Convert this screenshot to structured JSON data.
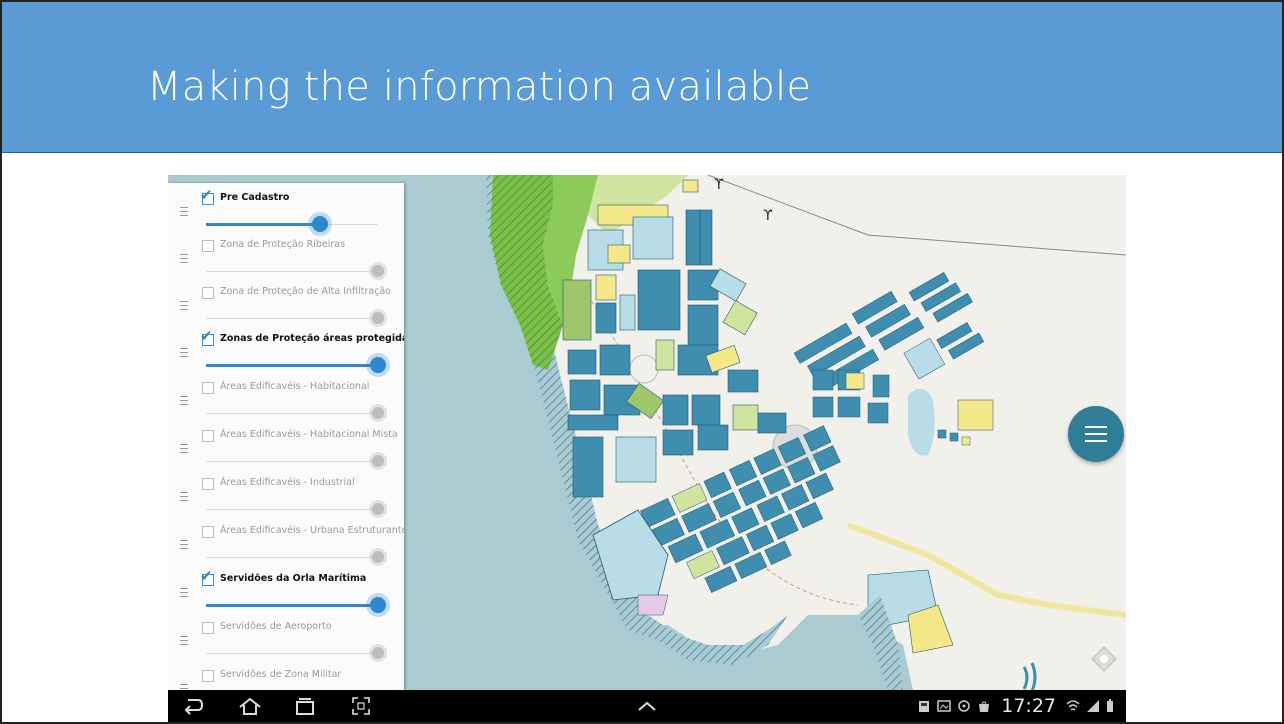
{
  "slide": {
    "title": "Making the information available"
  },
  "layers": [
    {
      "label": "Pre Cadastro",
      "checked": true,
      "opacity": 0.64
    },
    {
      "label": "Zona de Proteção Ribeiras",
      "checked": false,
      "opacity": 1.0
    },
    {
      "label": "Zona de Proteção de Alta Infiltração",
      "checked": false,
      "opacity": 1.0
    },
    {
      "label": "Zonas de Proteção áreas protegidas",
      "checked": true,
      "opacity": 1.0
    },
    {
      "label": "Áreas Edificavéis - Habitacional",
      "checked": false,
      "opacity": 1.0
    },
    {
      "label": "Áreas Edificavéis - Habitacional Mista",
      "checked": false,
      "opacity": 1.0
    },
    {
      "label": "Áreas Edificavéis - Industrial",
      "checked": false,
      "opacity": 1.0
    },
    {
      "label": "Áreas Edificavéis - Urbana Estruturante",
      "checked": false,
      "opacity": 1.0
    },
    {
      "label": "Servidões da Orla Marítima",
      "checked": true,
      "opacity": 1.0
    },
    {
      "label": "Servidões de Aeroporto",
      "checked": false,
      "opacity": 1.0
    },
    {
      "label": "Servidões de Zona Militar",
      "checked": false,
      "opacity": 1.0
    }
  ],
  "map": {
    "menu_icon": "hamburger-icon",
    "locate_icon": "compass-icon",
    "colors": {
      "sea": "#aacbd1",
      "land": "#f2f0ea",
      "parcel": "#3f8eb0",
      "parcel_light": "#b9dde6",
      "green": "#c9df9b",
      "dark_green": "#6aa84f",
      "yellow": "#f5e88a"
    }
  },
  "status_bar": {
    "clock": "17:27",
    "icons": [
      "screenshot-icon",
      "gallery-icon",
      "sync-icon",
      "bag-icon",
      "wifi-icon",
      "signal-icon",
      "battery-icon"
    ]
  },
  "nav_bar": {
    "icons": [
      "back-icon",
      "home-icon",
      "recent-apps-icon",
      "screenshot-capture-icon",
      "chevron-up-icon"
    ]
  }
}
